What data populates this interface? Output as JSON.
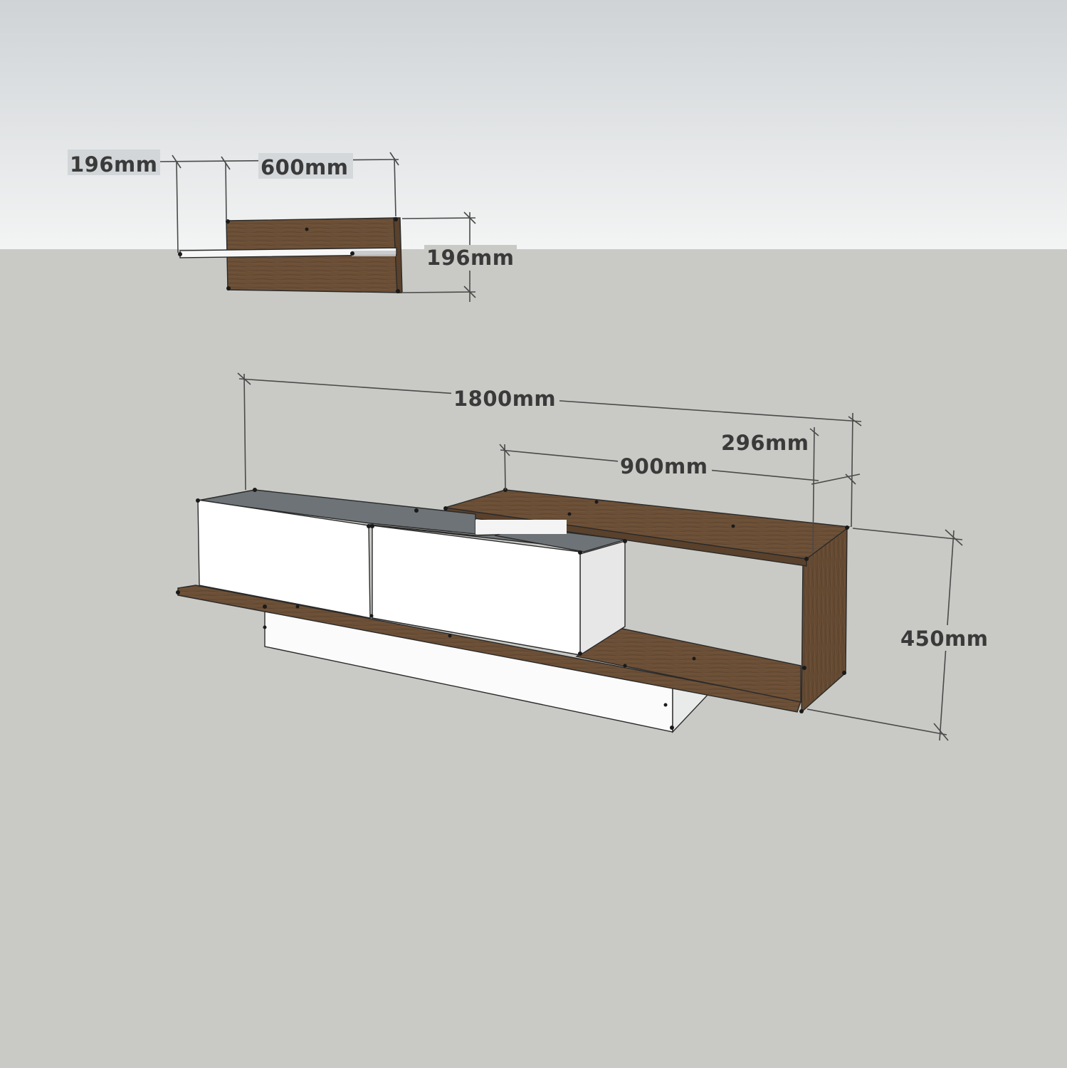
{
  "colors": {
    "sky_top": "#cfd3d6",
    "sky_bottom": "#f3f4f4",
    "floor": "#c9cac5",
    "wood": "#6b4f36",
    "wood_dark": "#5a412c",
    "white_panel": "#ffffff",
    "grey_panel": "#6d7376",
    "label": "#3a3a3a"
  },
  "dimensions": {
    "wall_shelf_depth": "196mm",
    "wall_shelf_width": "600mm",
    "wall_shelf_height": "196mm",
    "unit_total_width": "1800mm",
    "unit_top_depth": "296mm",
    "unit_top_width": "900mm",
    "unit_height": "450mm"
  }
}
